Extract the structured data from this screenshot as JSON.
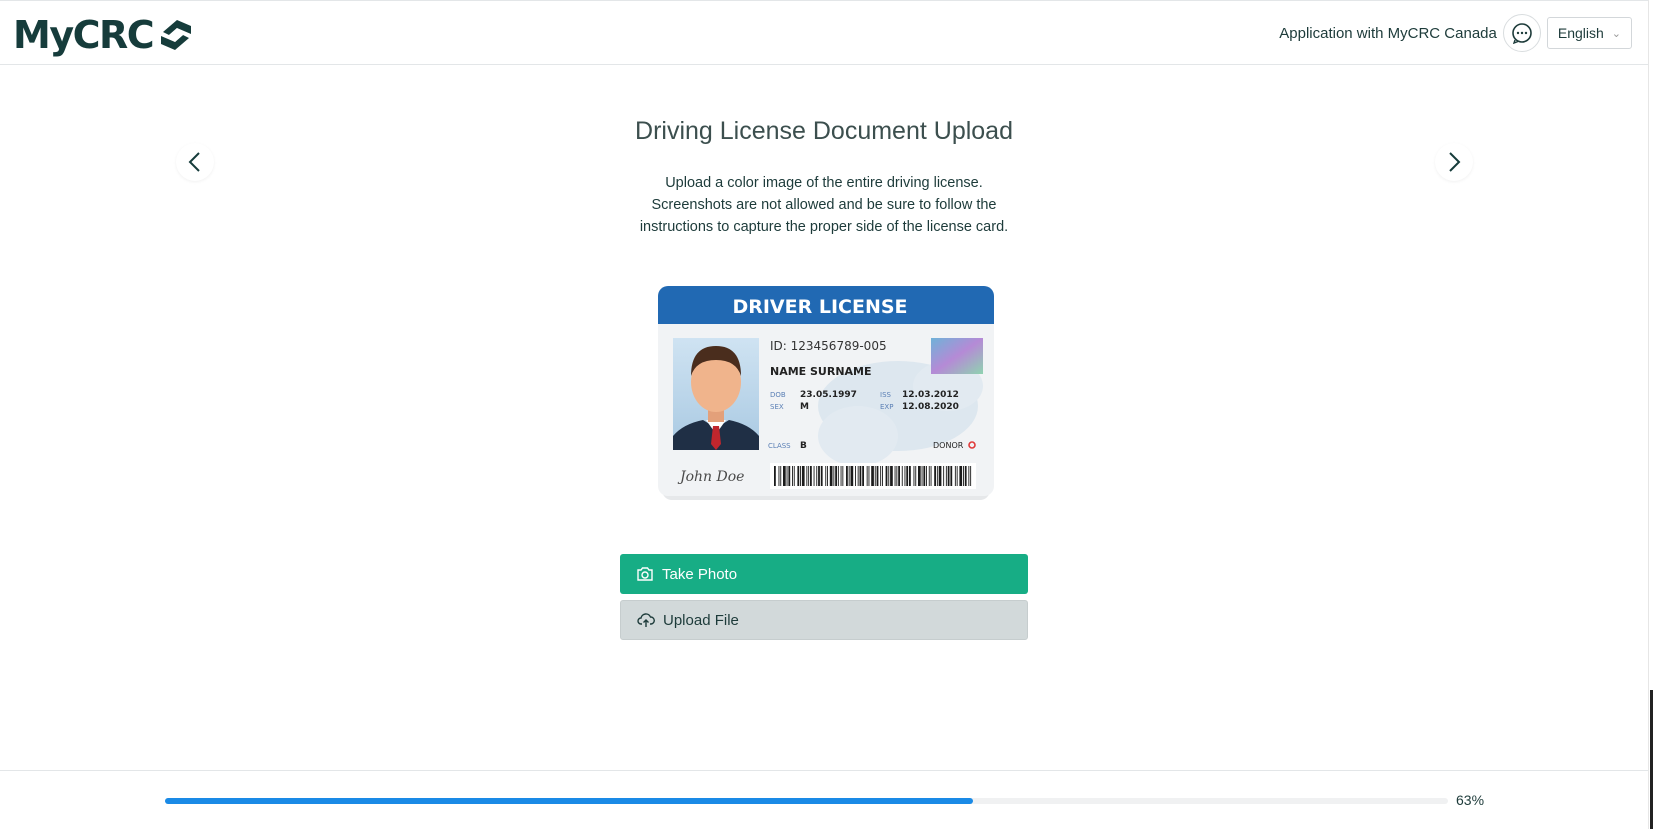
{
  "header": {
    "logo_text": "MyCRC",
    "application_text": "Application with MyCRC Canada",
    "language": "English"
  },
  "main": {
    "title": "Driving License Document Upload",
    "description_lines": [
      "Upload a color image of the entire driving license.",
      "Screenshots are not allowed and be sure to follow the",
      "instructions to capture the proper side of the license card."
    ],
    "card": {
      "header": "DRIVER LICENSE",
      "id": "ID: 123456789-005",
      "name": "NAME SURNAME",
      "dob_label": "DOB",
      "dob": "23.05.1997",
      "sex_label": "SEX",
      "sex": "M",
      "iss_label": "ISS",
      "iss": "12.03.2012",
      "exp_label": "EXP",
      "exp": "12.08.2020",
      "class_label": "CLASS",
      "class": "B",
      "donor_label": "DONOR",
      "signature": "John Doe"
    },
    "take_photo_label": "Take Photo",
    "upload_file_label": "Upload File"
  },
  "footer": {
    "progress_percent": 63,
    "progress_label": "63%"
  },
  "colors": {
    "brand_dark": "#163c3b",
    "primary_green": "#17ad85",
    "progress_blue": "#1a8ae6",
    "card_blue": "#2169b3"
  },
  "icons": [
    "chat-bubble-icon",
    "chevron-down-icon",
    "chevron-left-icon",
    "chevron-right-icon",
    "camera-icon",
    "cloud-upload-icon"
  ]
}
